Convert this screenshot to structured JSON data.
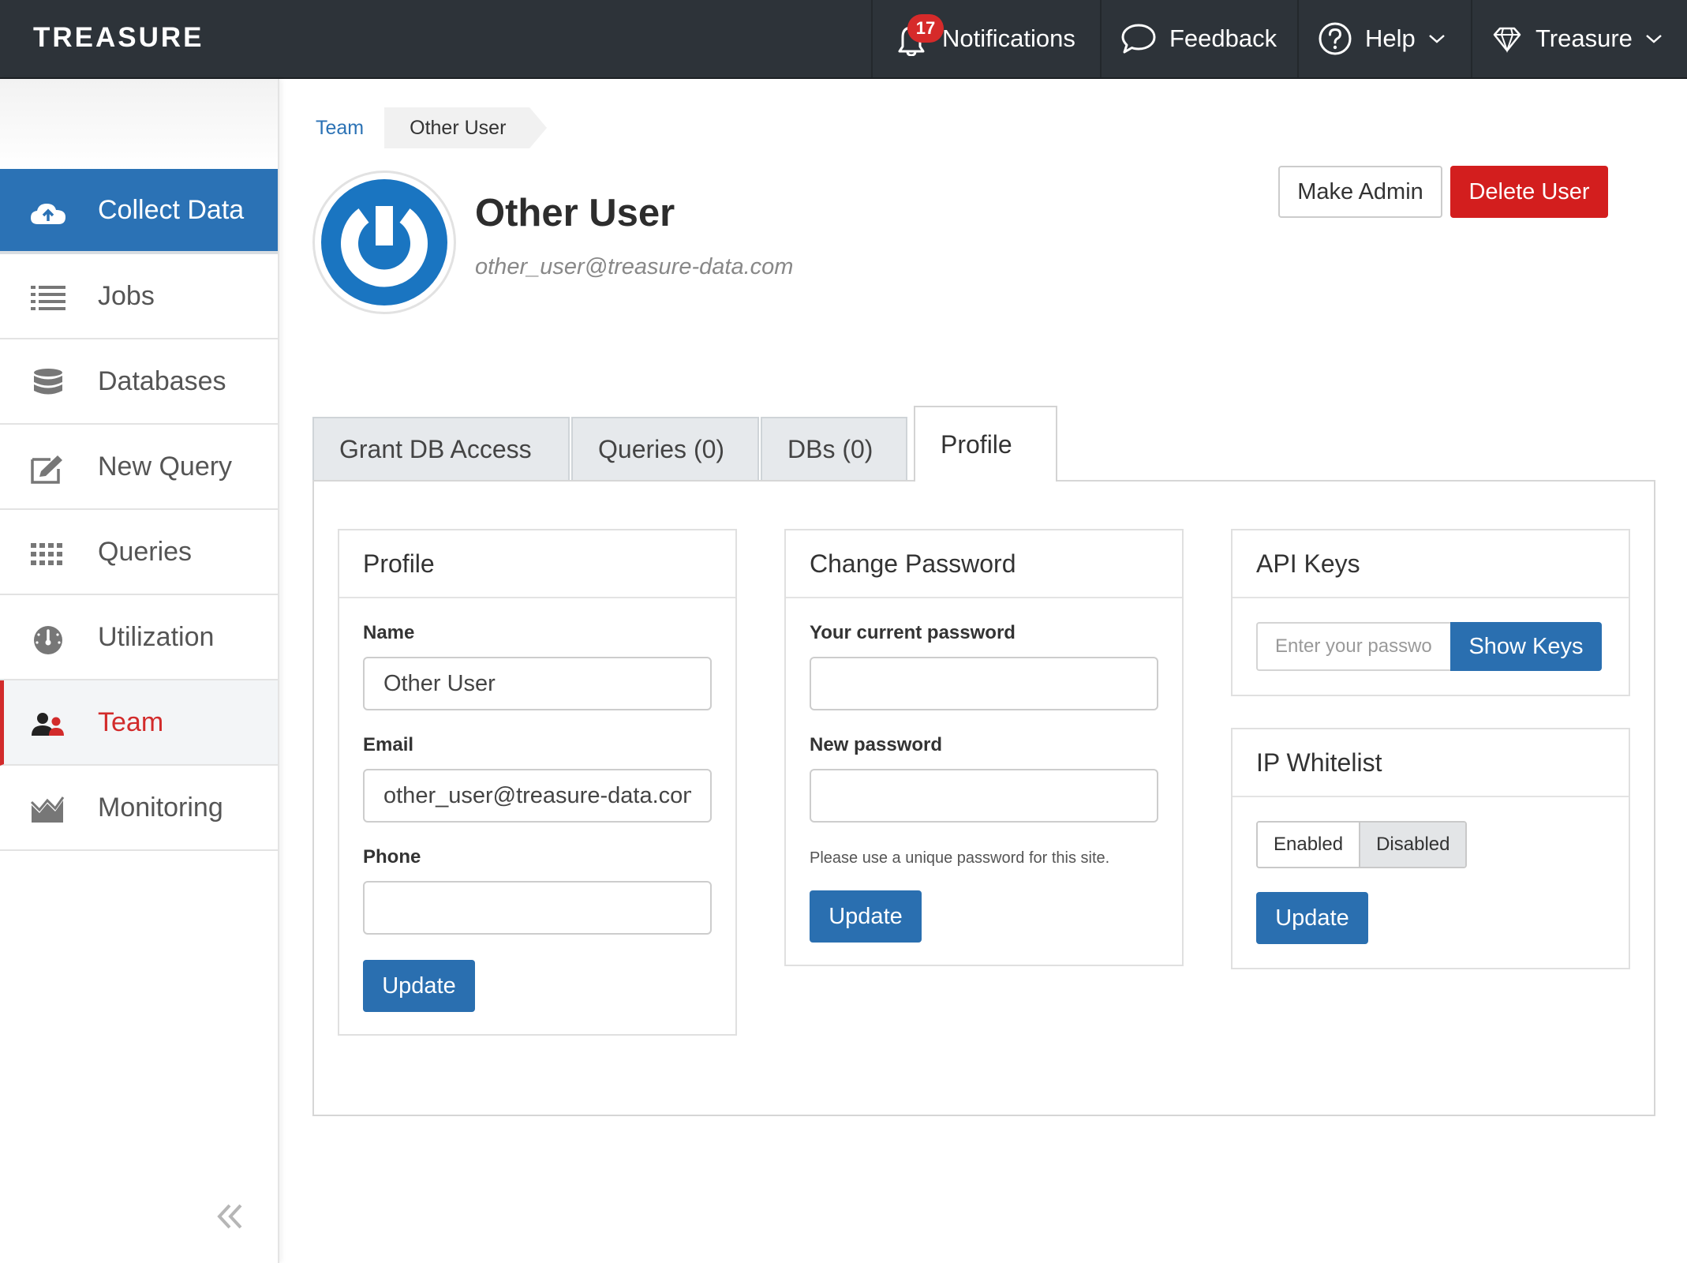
{
  "header": {
    "logo": "TREASURE",
    "notifications": {
      "count": "17",
      "label": "Notifications"
    },
    "feedback_label": "Feedback",
    "help_label": "Help",
    "account_label": "Treasure"
  },
  "sidebar": {
    "items": [
      {
        "label": "Collect Data",
        "icon": "cloud-upload-icon",
        "state": "highlighted"
      },
      {
        "label": "Jobs",
        "icon": "list-icon"
      },
      {
        "label": "Databases",
        "icon": "database-icon"
      },
      {
        "label": "New Query",
        "icon": "edit-icon"
      },
      {
        "label": "Queries",
        "icon": "grid-icon"
      },
      {
        "label": "Utilization",
        "icon": "gauge-icon"
      },
      {
        "label": "Team",
        "icon": "users-icon",
        "state": "active"
      },
      {
        "label": "Monitoring",
        "icon": "chart-icon"
      }
    ],
    "collapse_icon": "double-chevron-left-icon"
  },
  "breadcrumb": {
    "parent": "Team",
    "current": "Other User"
  },
  "user": {
    "name": "Other User",
    "email": "other_user@treasure-data.com"
  },
  "actions": {
    "make_admin": "Make Admin",
    "delete_user": "Delete User"
  },
  "tabs": [
    {
      "label": "Grant DB Access"
    },
    {
      "label": "Queries (0)"
    },
    {
      "label": "DBs (0)"
    },
    {
      "label": "Profile",
      "active": true
    }
  ],
  "profile_card": {
    "title": "Profile",
    "name_label": "Name",
    "name_value": "Other User",
    "email_label": "Email",
    "email_value": "other_user@treasure-data.com",
    "phone_label": "Phone",
    "phone_value": "",
    "update": "Update"
  },
  "password_card": {
    "title": "Change Password",
    "current_label": "Your current password",
    "new_label": "New password",
    "hint": "Please use a unique password for this site.",
    "update": "Update"
  },
  "api_card": {
    "title": "API Keys",
    "placeholder": "Enter your password",
    "show_keys": "Show Keys"
  },
  "ip_card": {
    "title": "IP Whitelist",
    "enabled": "Enabled",
    "disabled": "Disabled",
    "selected": "Disabled",
    "update": "Update"
  },
  "colors": {
    "topbar": "#2d3339",
    "primary": "#2a6fb0",
    "danger": "#d31e1e",
    "active_nav": "#d22b2b"
  }
}
